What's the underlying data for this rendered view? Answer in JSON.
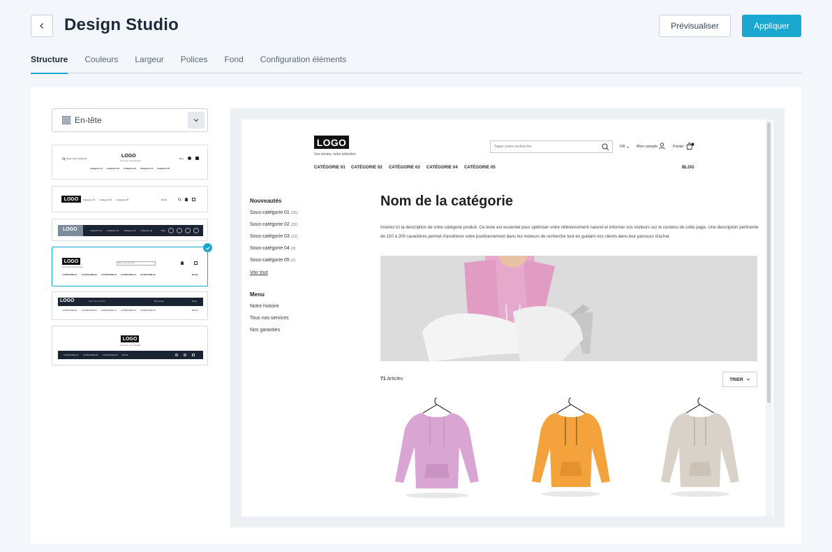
{
  "header": {
    "title": "Design Studio",
    "preview_label": "Prévisualiser",
    "apply_label": "Appliquer"
  },
  "tabs": [
    {
      "label": "Structure",
      "active": true
    },
    {
      "label": "Couleurs"
    },
    {
      "label": "Largeur"
    },
    {
      "label": "Polices"
    },
    {
      "label": "Fond"
    },
    {
      "label": "Configuration éléments"
    }
  ],
  "section_select": {
    "value": "En-tête"
  },
  "thumbnails": {
    "t1": {
      "search": "Taper votre recherche",
      "logo": "LOGO",
      "tagline": "Vos envies, notre sélection",
      "blog": "Blog",
      "nav": [
        "Catégorie 01",
        "Catégorie 02",
        "Catégorie 03",
        "Catégorie 04",
        "Catégorie 05"
      ]
    },
    "t2": {
      "logo": "LOGO",
      "nav": [
        "Catégorie 01",
        "Catégorie 02",
        "Catégorie 03"
      ],
      "blog": "BLOG"
    },
    "t3": {
      "logo": "LOGO",
      "nav": [
        "Catégorie 01",
        "Catégorie 02",
        "Catégorie 03",
        "Catégorie 04"
      ],
      "blog": "Blog"
    },
    "t4": {
      "logo": "LOGO",
      "tagline": "Vos envies, notre sélection",
      "search": "Taper votre recherche",
      "nav": [
        "CATÉGORIE 01",
        "CATÉGORIE 02",
        "CATÉGORIE 03",
        "CATÉGORIE 04",
        "CATÉGORIE 05"
      ],
      "blog": "BLOG"
    },
    "t5": {
      "logo": "LOGO",
      "search": "Taper votre recherche",
      "account": "Mon compte",
      "cart": "Panier",
      "nav": [
        "CATÉGORIE 01",
        "CATÉGORIE 02",
        "CATÉGORIE 03",
        "CATÉGORIE 04",
        "CATÉGORIE 05"
      ],
      "blog": "BLOG"
    },
    "t6": {
      "logo": "LOGO",
      "tagline": "Vos envies, notre sélection",
      "nav": [
        "CATÉGORIE 01",
        "CATÉGORIE 02",
        "CATÉGORIE 03",
        "BLOG"
      ]
    }
  },
  "preview": {
    "logo": "LOGO",
    "tagline": "Vos envies, notre sélection",
    "search_placeholder": "Taper votre recherche",
    "lang": "FR",
    "account": "Mon compte",
    "cart": "Panier",
    "nav": [
      "CATÉGORIE 01",
      "CATÉGORIE 02",
      "CATÉGORIE 03",
      "CATÉGORIE 04",
      "CATÉGORIE 05"
    ],
    "blog": "BLOG",
    "sidebar": {
      "new_heading": "Nouveautés",
      "subcats": [
        {
          "name": "Sous-catégorie 01",
          "count": "(26)"
        },
        {
          "name": "Sous-catégorie 02",
          "count": "(32)"
        },
        {
          "name": "Sous-catégorie 03",
          "count": "(22)"
        },
        {
          "name": "Sous-catégorie 04",
          "count": "(9)"
        },
        {
          "name": "Sous-catégorie 05",
          "count": "(2)"
        }
      ],
      "see_all": "Voir tout",
      "menu_heading": "Menu",
      "menu_items": [
        "Notre histoire",
        "Tous nos services",
        "Nos garanties"
      ]
    },
    "category_title": "Nom de la catégorie",
    "category_description": "Insérez ici la description de votre catégorie produit. Ce texte est essentiel pour optimiser votre référencement naturel et informer vos visiteurs sur le contenu de cette page. Une description pertinente de 150 à 200 caractères permet d'améliorer votre positionnement dans les moteurs de recherche tout en guidant vos clients dans leur parcours d'achat.",
    "article_count": "71",
    "article_label": "Articles",
    "sort_label": "TRIER"
  },
  "colors": {
    "accent": "#1aa8d0",
    "title": "#1c2a39",
    "dark_bar": "#1b2433",
    "hoodie_pink": "#d9a6d3",
    "hoodie_orange": "#f4a23c",
    "hoodie_beige": "#d9d2c8"
  }
}
